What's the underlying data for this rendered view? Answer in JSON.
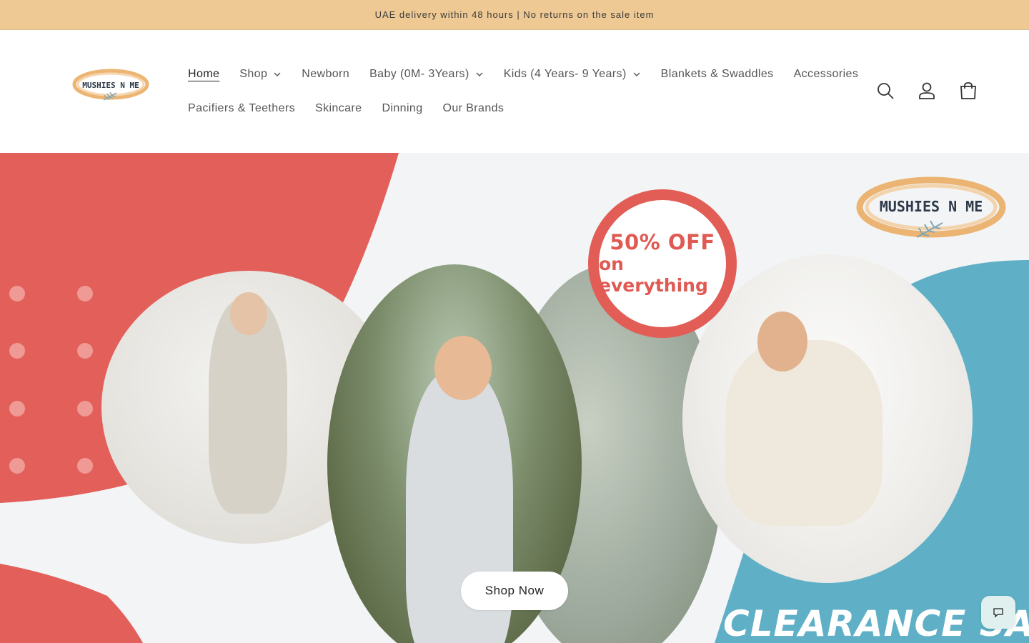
{
  "announcement": {
    "text": "UAE delivery within 48 hours | No returns on the sale item"
  },
  "header": {
    "logo_text": "MUSHIES N ME",
    "nav_row1": [
      {
        "label": "Home",
        "active": true,
        "dropdown": false
      },
      {
        "label": "Shop",
        "active": false,
        "dropdown": true
      },
      {
        "label": "Newborn",
        "active": false,
        "dropdown": false
      },
      {
        "label": "Baby (0M- 3Years)",
        "active": false,
        "dropdown": true
      },
      {
        "label": "Kids (4 Years- 9 Years)",
        "active": false,
        "dropdown": true
      },
      {
        "label": "Blankets & Swaddles",
        "active": false,
        "dropdown": false
      },
      {
        "label": "Accessories",
        "active": false,
        "dropdown": false
      }
    ],
    "nav_row2": [
      {
        "label": "Pacifiers & Teethers",
        "active": false,
        "dropdown": false
      },
      {
        "label": "Skincare",
        "active": false,
        "dropdown": false
      },
      {
        "label": "Dinning",
        "active": false,
        "dropdown": false
      },
      {
        "label": "Our Brands",
        "active": false,
        "dropdown": false
      }
    ],
    "icons": [
      "search-icon",
      "account-icon",
      "cart-icon"
    ]
  },
  "hero": {
    "badge_line1": "50% OFF",
    "badge_line2": "on everything",
    "logo_text": "MUSHIES N ME",
    "cta_label": "Shop Now",
    "headline": "CLEARANCE SALE"
  },
  "colors": {
    "announcement_bg": "#eec994",
    "accent_red": "#e15d56",
    "accent_blue": "#5fb0c6",
    "logo_orange": "#eaa85c"
  },
  "chat": {
    "icon": "chat-icon"
  }
}
